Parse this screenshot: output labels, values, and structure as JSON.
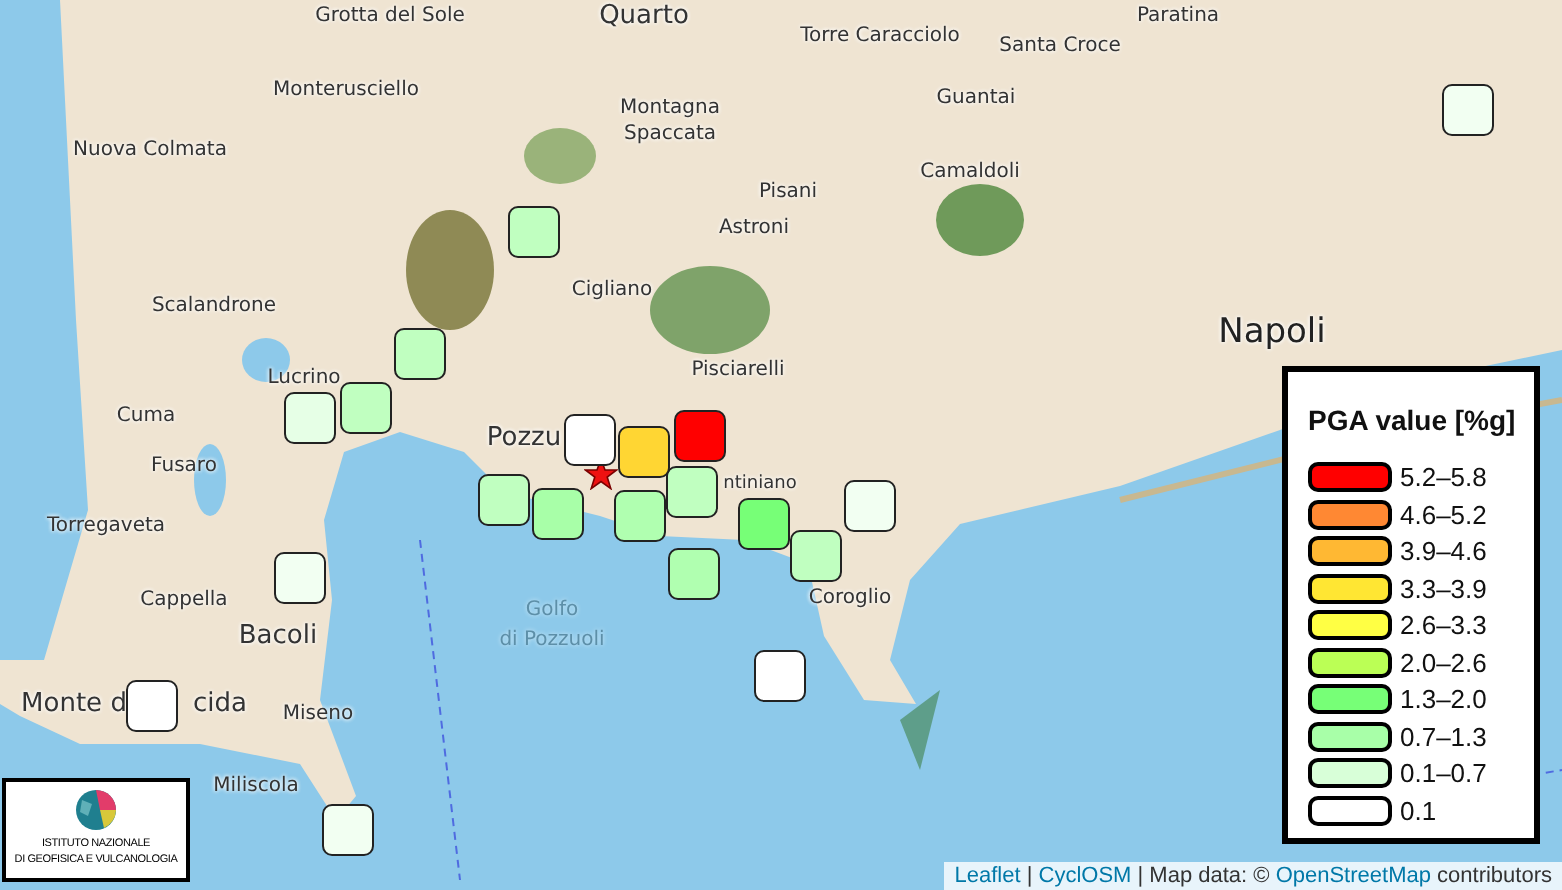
{
  "map": {
    "places": [
      {
        "name": "Grotta del Sole",
        "kind": "town"
      },
      {
        "name": "Quarto",
        "kind": "city"
      },
      {
        "name": "Torre Caracciolo",
        "kind": "town"
      },
      {
        "name": "Santa Croce",
        "kind": "town"
      },
      {
        "name": "Paratina",
        "kind": "town"
      },
      {
        "name": "Monterusciello",
        "kind": "town"
      },
      {
        "name": "Montagna",
        "kind": "town"
      },
      {
        "name": "Spaccata",
        "kind": "town"
      },
      {
        "name": "Guantai",
        "kind": "town"
      },
      {
        "name": "Nuova Colmata",
        "kind": "town"
      },
      {
        "name": "Camaldoli",
        "kind": "town"
      },
      {
        "name": "Pisani",
        "kind": "town"
      },
      {
        "name": "Astroni",
        "kind": "town"
      },
      {
        "name": "Scalandrone",
        "kind": "town"
      },
      {
        "name": "Cigliano",
        "kind": "town"
      },
      {
        "name": "Napoli",
        "kind": "capital"
      },
      {
        "name": "Pisciarelli",
        "kind": "town"
      },
      {
        "name": "Lucrino",
        "kind": "town"
      },
      {
        "name": "Cuma",
        "kind": "town"
      },
      {
        "name": "Pozzu",
        "kind": "city"
      },
      {
        "name": "Fusaro",
        "kind": "town"
      },
      {
        "name": "ntiniano",
        "kind": "town"
      },
      {
        "name": "Torregaveta",
        "kind": "town"
      },
      {
        "name": "Cappella",
        "kind": "town"
      },
      {
        "name": "Golfo",
        "kind": "water"
      },
      {
        "name": "Coroglio",
        "kind": "town"
      },
      {
        "name": "Bacoli",
        "kind": "city"
      },
      {
        "name": "di Pozzuoli",
        "kind": "water"
      },
      {
        "name": "Monte d",
        "kind": "city"
      },
      {
        "name": "cida",
        "kind": "city"
      },
      {
        "name": "Miseno",
        "kind": "town"
      },
      {
        "name": "Miliscola",
        "kind": "town"
      }
    ],
    "stations": [
      {
        "color": "#f2fff2"
      },
      {
        "color": "#c0ffc0"
      },
      {
        "color": "#c0ffc0"
      },
      {
        "color": "#e6ffe6"
      },
      {
        "color": "#c0ffc0"
      },
      {
        "color": "#ffffff"
      },
      {
        "color": "#c0ffc0"
      },
      {
        "color": "#a8ffa8"
      },
      {
        "color": "#c0ffc0"
      },
      {
        "color": "#b0ffb0"
      },
      {
        "color": "#b0ffb0"
      },
      {
        "color": "#ffd633"
      },
      {
        "color": "#ff0000"
      },
      {
        "color": "#77ff77"
      },
      {
        "color": "#c0ffc0"
      },
      {
        "color": "#f2fff2"
      },
      {
        "color": "#f2fff2"
      },
      {
        "color": "#ffffff"
      },
      {
        "color": "#ffffff"
      },
      {
        "color": "#f2fff2"
      }
    ]
  },
  "legend": {
    "title": "PGA value [%g]",
    "items": [
      {
        "label": "5.2–5.8",
        "color": "#ff0000"
      },
      {
        "label": "4.6–5.2",
        "color": "#ff8833"
      },
      {
        "label": "3.9–4.6",
        "color": "#ffb833"
      },
      {
        "label": "3.3–3.9",
        "color": "#ffe633"
      },
      {
        "label": "2.6–3.3",
        "color": "#ffff44"
      },
      {
        "label": "2.0–2.6",
        "color": "#bbff55"
      },
      {
        "label": "1.3–2.0",
        "color": "#77ff77"
      },
      {
        "label": "0.7–1.3",
        "color": "#a8ffa8"
      },
      {
        "label": "0.1–0.7",
        "color": "#d8ffd8"
      },
      {
        "label": "0.1",
        "color": "#ffffff"
      }
    ]
  },
  "logo": {
    "lines": [
      "ISTITUTO NAZIONALE",
      "DI GEOFISICA E VULCANOLOGIA"
    ]
  },
  "attribution": {
    "parts": [
      {
        "text": "Leaflet",
        "kind": "link"
      },
      {
        "text": " | ",
        "kind": "text"
      },
      {
        "text": "CyclOSM",
        "kind": "link"
      },
      {
        "text": " | Map data: © ",
        "kind": "text"
      },
      {
        "text": "OpenStreetMap",
        "kind": "link"
      },
      {
        "text": " contributors",
        "kind": "text"
      }
    ]
  }
}
